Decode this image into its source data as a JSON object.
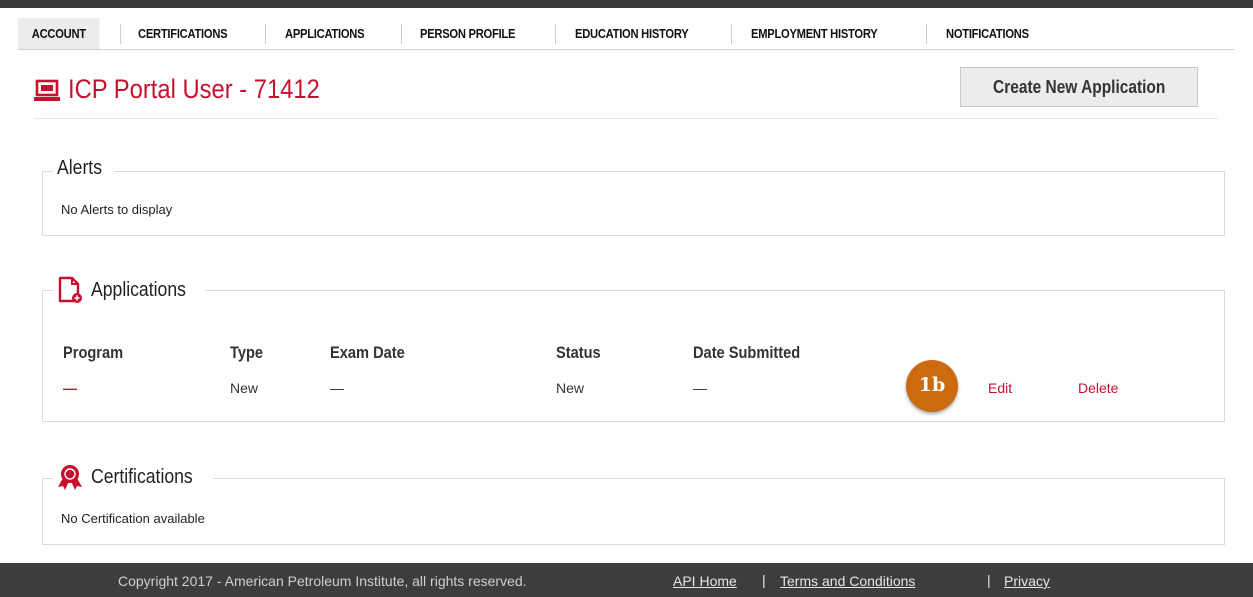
{
  "tabs": [
    {
      "label": "ACCOUNT",
      "active": true
    },
    {
      "label": "CERTIFICATIONS",
      "active": false
    },
    {
      "label": "APPLICATIONS",
      "active": false
    },
    {
      "label": "PERSON PROFILE",
      "active": false
    },
    {
      "label": "EDUCATION HISTORY",
      "active": false
    },
    {
      "label": "EMPLOYMENT HISTORY",
      "active": false
    },
    {
      "label": "NOTIFICATIONS",
      "active": false
    }
  ],
  "header": {
    "title": "ICP Portal User - 71412",
    "title_icon": "laptop-icon",
    "create_button_label": "Create New Application"
  },
  "alerts": {
    "legend": "Alerts",
    "message": "No Alerts to display"
  },
  "applications": {
    "legend": "Applications",
    "icon": "document-plus-icon",
    "columns": [
      "Program",
      "Type",
      "Exam Date",
      "Status",
      "Date Submitted"
    ],
    "rows": [
      {
        "program": "—",
        "type": "New",
        "exam_date": "—",
        "status": "New",
        "date_submitted": "—",
        "edit_label": "Edit",
        "delete_label": "Delete"
      }
    ],
    "callout_badge": "1b"
  },
  "certifications": {
    "legend": "Certifications",
    "icon": "award-ribbon-icon",
    "message": "No Certification available"
  },
  "footer": {
    "copyright": "Copyright 2017 - American Petroleum Institute, all rights reserved.",
    "links": [
      "API Home",
      "Terms and Conditions",
      "Privacy"
    ],
    "separator": "|"
  },
  "colors": {
    "accent": "#c8102e",
    "footer_bg": "#3d3d3d",
    "badge": "#cc6a10"
  }
}
